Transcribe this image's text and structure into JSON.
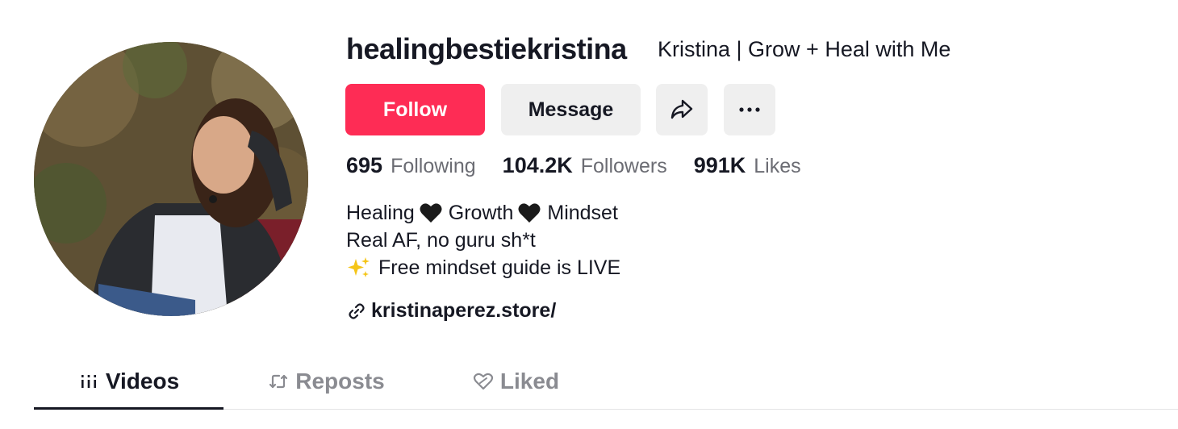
{
  "profile": {
    "username": "healingbestiekristina",
    "nickname": "Kristina | Grow + Heal with Me"
  },
  "actions": {
    "follow_label": "Follow",
    "message_label": "Message",
    "share_icon": "share-arrow-icon",
    "more_icon": "ellipsis-icon"
  },
  "stats": {
    "following": {
      "value": "695",
      "label": "Following"
    },
    "followers": {
      "value": "104.2K",
      "label": "Followers"
    },
    "likes": {
      "value": "991K",
      "label": "Likes"
    }
  },
  "bio": {
    "line1": {
      "part1": "Healing",
      "part2": "Growth",
      "part3": "Mindset"
    },
    "line2": "Real AF, no guru sh*t",
    "line3": "Free mindset guide is LIVE"
  },
  "link": {
    "text": "kristinaperez.store/"
  },
  "tabs": [
    {
      "label": "Videos",
      "icon": "grid-icon",
      "active": true
    },
    {
      "label": "Reposts",
      "icon": "repost-icon",
      "active": false
    },
    {
      "label": "Liked",
      "icon": "heart-icon",
      "active": false
    }
  ],
  "colors": {
    "accent": "#fe2c55",
    "secondary_button": "#efefef",
    "text_primary": "#161823",
    "text_secondary": "#6b6c73"
  }
}
